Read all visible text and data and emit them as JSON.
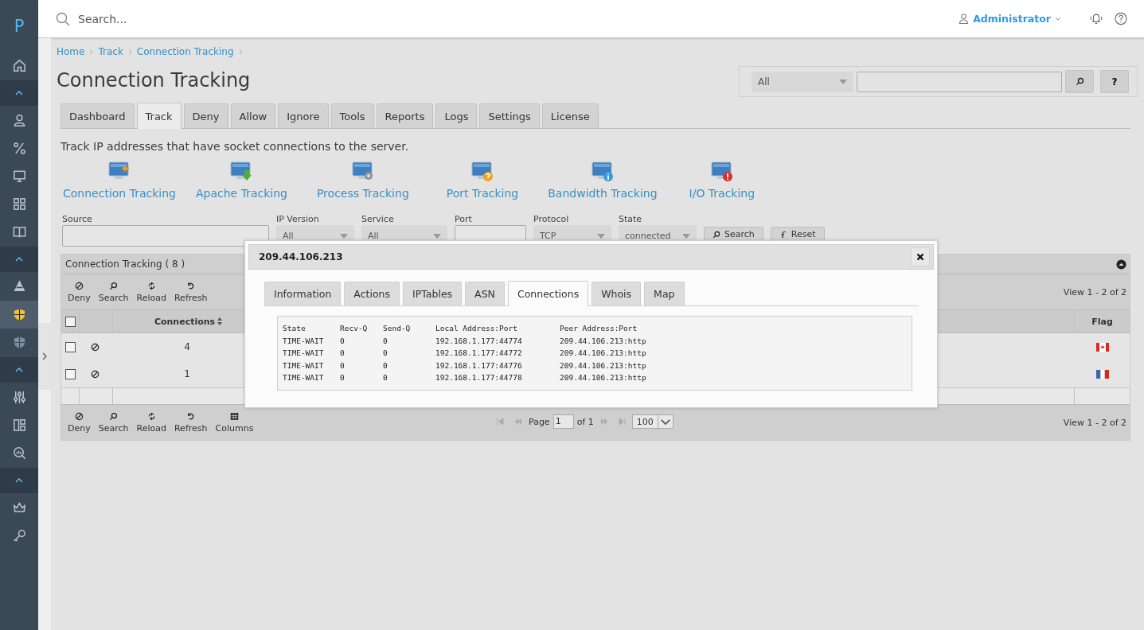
{
  "sidebar": {
    "logo": "P",
    "items": [
      {
        "kind": "link",
        "selected": false
      },
      {
        "kind": "section",
        "expanded": true
      },
      {
        "kind": "link",
        "selected": false
      },
      {
        "kind": "link",
        "selected": false
      },
      {
        "kind": "link",
        "selected": false
      },
      {
        "kind": "link",
        "selected": false
      },
      {
        "kind": "link",
        "selected": false
      },
      {
        "kind": "section",
        "expanded": true
      },
      {
        "kind": "link",
        "selected": false
      },
      {
        "kind": "link",
        "selected": true
      },
      {
        "kind": "link",
        "selected": false
      },
      {
        "kind": "section",
        "expanded": true
      },
      {
        "kind": "link",
        "selected": false
      },
      {
        "kind": "link",
        "selected": false
      },
      {
        "kind": "link",
        "selected": false
      },
      {
        "kind": "section",
        "expanded": true
      },
      {
        "kind": "link",
        "selected": false
      },
      {
        "kind": "link",
        "selected": false
      }
    ]
  },
  "topbar": {
    "search_placeholder": "Search...",
    "user": "Administrator"
  },
  "breadcrumb": [
    "Home",
    "Track",
    "Connection Tracking"
  ],
  "title": "Connection Tracking",
  "quick_search": {
    "scope": "All",
    "help": "?"
  },
  "tabs": [
    {
      "label": "Dashboard",
      "selected": false
    },
    {
      "label": "Track",
      "selected": true
    },
    {
      "label": "Deny",
      "selected": false
    },
    {
      "label": "Allow",
      "selected": false
    },
    {
      "label": "Ignore",
      "selected": false
    },
    {
      "label": "Tools",
      "selected": false
    },
    {
      "label": "Reports",
      "selected": false
    },
    {
      "label": "Logs",
      "selected": false
    },
    {
      "label": "Settings",
      "selected": false
    },
    {
      "label": "License",
      "selected": false
    }
  ],
  "description": "Track IP addresses that have socket connections to the server.",
  "tracking_links": [
    "Connection Tracking",
    "Apache Tracking",
    "Process Tracking",
    "Port Tracking",
    "Bandwidth Tracking",
    "I/O Tracking"
  ],
  "filters": [
    {
      "kind": "input",
      "label": "Source"
    },
    {
      "kind": "select",
      "label": "IP Version",
      "value": "All"
    },
    {
      "kind": "select",
      "label": "Service",
      "value": "All"
    },
    {
      "kind": "input",
      "label": "Port"
    },
    {
      "kind": "select",
      "label": "Protocol",
      "value": "TCP"
    },
    {
      "kind": "select",
      "label": "State",
      "value": "connected"
    }
  ],
  "filter_buttons": [
    "Search",
    "Reset"
  ],
  "grid": {
    "title": "Connection Tracking ( 8 )",
    "select_all": {
      "checked": false
    },
    "toolbar": [
      "Deny",
      "Search",
      "Reload",
      "Refresh"
    ],
    "view": "View 1 - 2 of 2",
    "columns": [
      "Connections",
      "Flag"
    ],
    "rows": [
      {
        "checked": false,
        "connections": "4"
      },
      {
        "checked": false,
        "connections": "1"
      }
    ],
    "bottom_toolbar": [
      "Deny",
      "Search",
      "Reload",
      "Refresh",
      "Columns"
    ],
    "pager": {
      "page_label": "Page",
      "page": "1",
      "of": "of 1",
      "page_size": "100"
    },
    "bottom_view": "View 1 - 2 of 2"
  },
  "dialog": {
    "title": "209.44.106.213",
    "tabs": [
      {
        "label": "Information",
        "selected": false
      },
      {
        "label": "Actions",
        "selected": false
      },
      {
        "label": "IPTables",
        "selected": false
      },
      {
        "label": "ASN",
        "selected": false
      },
      {
        "label": "Connections",
        "selected": true
      },
      {
        "label": "Whois",
        "selected": false
      },
      {
        "label": "Map",
        "selected": false
      }
    ],
    "columns": [
      "State",
      "Recv-Q",
      "Send-Q",
      "Local Address:Port",
      "Peer Address:Port"
    ],
    "rows": [
      [
        "TIME-WAIT",
        "0",
        "0",
        "192.168.1.177:44774",
        "209.44.106.213:http"
      ],
      [
        "TIME-WAIT",
        "0",
        "0",
        "192.168.1.177:44772",
        "209.44.106.213:http"
      ],
      [
        "TIME-WAIT",
        "0",
        "0",
        "192.168.1.177:44776",
        "209.44.106.213:http"
      ],
      [
        "TIME-WAIT",
        "0",
        "0",
        "192.168.1.177:44778",
        "209.44.106.213:http"
      ]
    ]
  }
}
